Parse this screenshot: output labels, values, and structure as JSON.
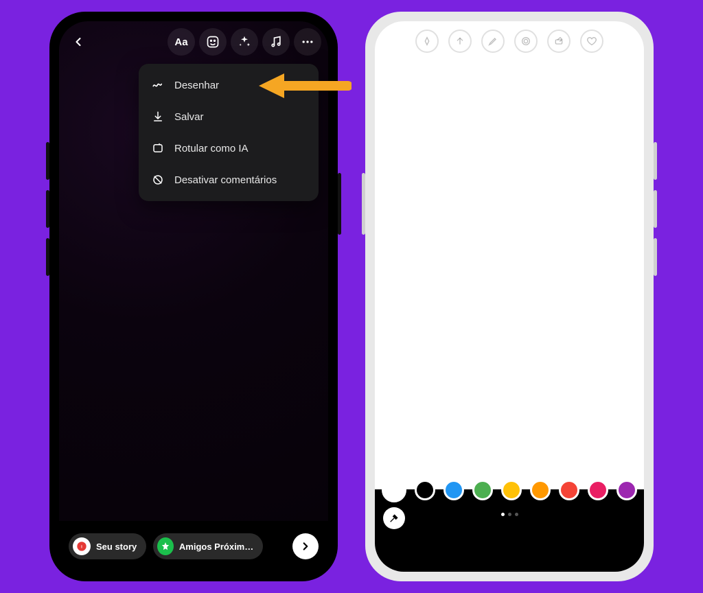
{
  "left": {
    "toolbar": {
      "text_tool": "Aa"
    },
    "menu": {
      "draw": "Desenhar",
      "save": "Salvar",
      "label_ai": "Rotular como IA",
      "disable_comments": "Desativar comentários"
    },
    "bottom": {
      "your_story": "Seu story",
      "close_friends": "Amigos Próxim…"
    }
  },
  "right": {
    "palette": [
      {
        "name": "white",
        "hex": "#ffffff",
        "selected": true
      },
      {
        "name": "black",
        "hex": "#000000"
      },
      {
        "name": "blue",
        "hex": "#2196f3"
      },
      {
        "name": "green",
        "hex": "#4caf50"
      },
      {
        "name": "yellow",
        "hex": "#ffc107"
      },
      {
        "name": "orange",
        "hex": "#ff9800"
      },
      {
        "name": "red",
        "hex": "#f44336"
      },
      {
        "name": "pink",
        "hex": "#e91e63"
      },
      {
        "name": "purple",
        "hex": "#9c27b0"
      }
    ],
    "page_dots": {
      "count": 3,
      "active": 0
    }
  }
}
